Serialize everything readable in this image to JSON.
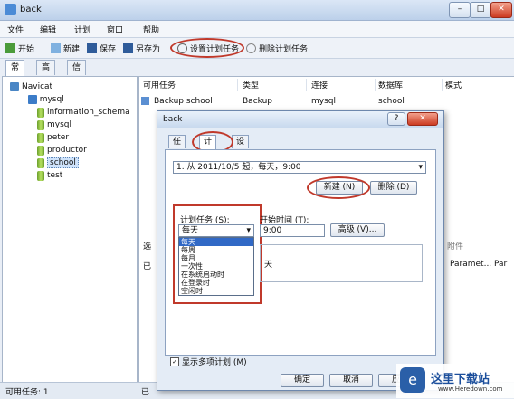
{
  "window": {
    "title": "back"
  },
  "menu": [
    "文件",
    "编辑",
    "计划",
    "窗口",
    "帮助"
  ],
  "toolbar": {
    "start": "开始",
    "new": "新建",
    "save": "保存",
    "save_as": "另存为",
    "set_task": "设置计划任务",
    "delete_task": "删除计划任务"
  },
  "left_tabs": [
    "常规",
    "高级",
    "信息日志"
  ],
  "tree": {
    "root": "Navicat",
    "connection": "mysql",
    "databases": [
      "information_schema",
      "mysql",
      "peter",
      "productor",
      "school",
      "test"
    ],
    "selected": "school"
  },
  "task_table": {
    "headers": [
      "可用任务",
      "类型",
      "连接",
      "数据库",
      "模式"
    ],
    "rows": [
      [
        "Backup school",
        "Backup",
        "mysql",
        "school",
        ""
      ]
    ]
  },
  "lower": {
    "label_left": "选",
    "label_right": "附件",
    "col1": "Paramet...",
    "col2": "Par",
    "left_char": "已"
  },
  "status": {
    "left": "可用任务: 1",
    "mid": "已"
  },
  "dialog": {
    "title": "back",
    "tabs": [
      "任务",
      "计划",
      "设置"
    ],
    "active_tab": "计划",
    "schedule_combo": "1. 从 2011/10/5 起，每天，9:00",
    "new_button": "新建 (N)",
    "delete_button": "删除 (D)",
    "schedule_task_label": "计划任务 (S):",
    "schedule_task_value": "每天",
    "options": [
      "每天",
      "每周",
      "每月",
      "一次性",
      "在系统启动时",
      "在登录时",
      "空闲时"
    ],
    "start_time_label": "开始时间 (T):",
    "start_time_value": "9:00",
    "advanced_button": "高级 (V)...",
    "day_text": "天",
    "multi_checkbox": "显示多项计划 (M)",
    "ok_button": "确定",
    "cancel_button": "取消",
    "apply_button": "应用"
  },
  "watermark": {
    "main": "这里下载站",
    "url": "www.Heredown.com"
  },
  "colors": {
    "accent": "#3169c6",
    "highlight_red": "#c0392b"
  }
}
